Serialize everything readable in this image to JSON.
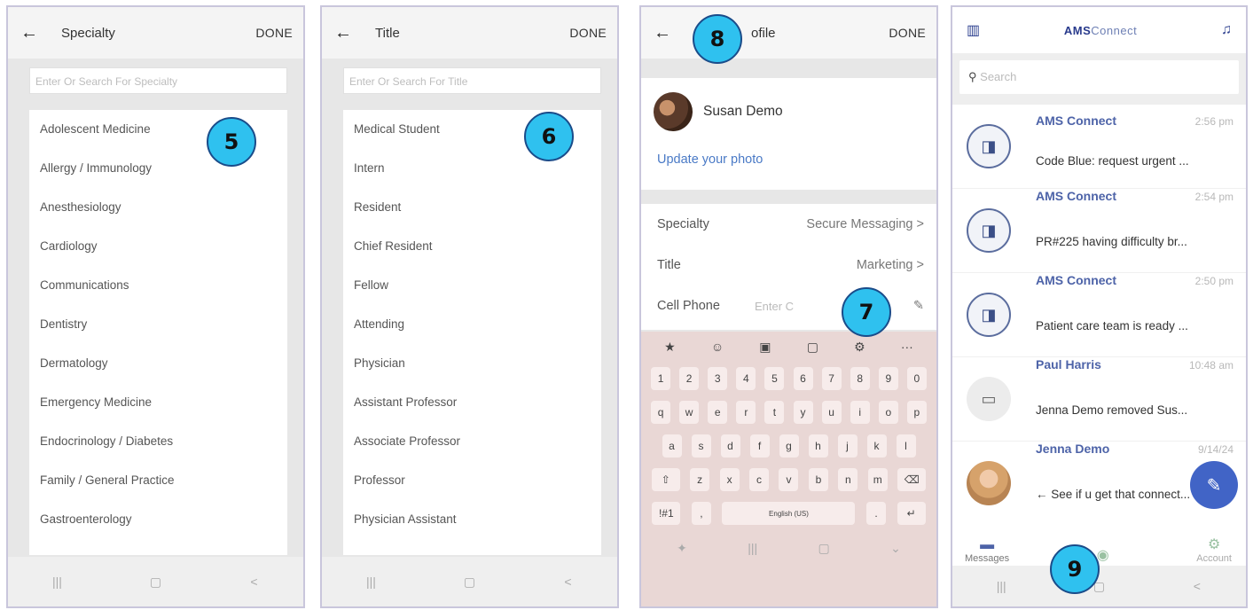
{
  "screen1": {
    "back_icon": "←",
    "title": "Specialty",
    "done": "DONE",
    "search_placeholder": "Enter Or Search For Specialty",
    "items": [
      "Adolescent Medicine",
      "Allergy / Immunology",
      "Anesthesiology",
      "Cardiology",
      "Communications",
      "Dentistry",
      "Dermatology",
      "Emergency Medicine",
      "Endocrinology / Diabetes",
      "Family / General Practice",
      "Gastroenterology"
    ],
    "badge": "5"
  },
  "screen2": {
    "back_icon": "←",
    "title": "Title",
    "done": "DONE",
    "search_placeholder": "Enter Or Search For Title",
    "items": [
      "Medical Student",
      "Intern",
      "Resident",
      "Chief Resident",
      "Fellow",
      "Attending",
      "Physician",
      "Assistant Professor",
      "Associate Professor",
      "Professor",
      "Physician Assistant"
    ],
    "badge": "6"
  },
  "screen3": {
    "back_icon": "←",
    "title": "ofile",
    "done": "DONE",
    "name": "Susan Demo",
    "update_photo": "Update your photo",
    "specialty_label": "Specialty",
    "specialty_value": "Secure Messaging >",
    "title_label": "Title",
    "title_value": "Marketing >",
    "cell_label": "Cell Phone",
    "cell_placeholder": "Enter C",
    "keyboard": {
      "tools": [
        "★",
        "☺",
        "▣",
        "▢",
        "⚙",
        "···"
      ],
      "numbers": [
        "1",
        "2",
        "3",
        "4",
        "5",
        "6",
        "7",
        "8",
        "9",
        "0"
      ],
      "row1": [
        "q",
        "w",
        "e",
        "r",
        "t",
        "y",
        "u",
        "i",
        "o",
        "p"
      ],
      "row2": [
        "a",
        "s",
        "d",
        "f",
        "g",
        "h",
        "j",
        "k",
        "l"
      ],
      "row3": [
        "⇧",
        "z",
        "x",
        "c",
        "v",
        "b",
        "n",
        "m",
        "⌫"
      ],
      "bottom": [
        "!#1",
        ",",
        "English (US)",
        ".",
        "↵"
      ]
    },
    "badge7": "7",
    "badge8": "8"
  },
  "screen4": {
    "logo_main": "AMS",
    "logo_sub": "Connect",
    "search_placeholder": "Search",
    "messages": [
      {
        "sender": "AMS Connect",
        "time": "2:56 pm",
        "preview": "Code Blue: request urgent ..."
      },
      {
        "sender": "AMS Connect",
        "time": "2:54 pm",
        "preview": "PR#225 having difficulty br..."
      },
      {
        "sender": "AMS Connect",
        "time": "2:50 pm",
        "preview": "Patient care team is ready ..."
      },
      {
        "sender": "Paul Harris",
        "time": "10:48 am",
        "preview": "Jenna Demo removed Sus..."
      },
      {
        "sender": "Jenna Demo",
        "time": "9/14/24",
        "preview": "← See if u get that connect..."
      }
    ],
    "tabs": [
      "Messages",
      "",
      "Account"
    ],
    "badge": "9"
  },
  "nav": {
    "recent": "|||",
    "home": "▢",
    "back": "<"
  }
}
